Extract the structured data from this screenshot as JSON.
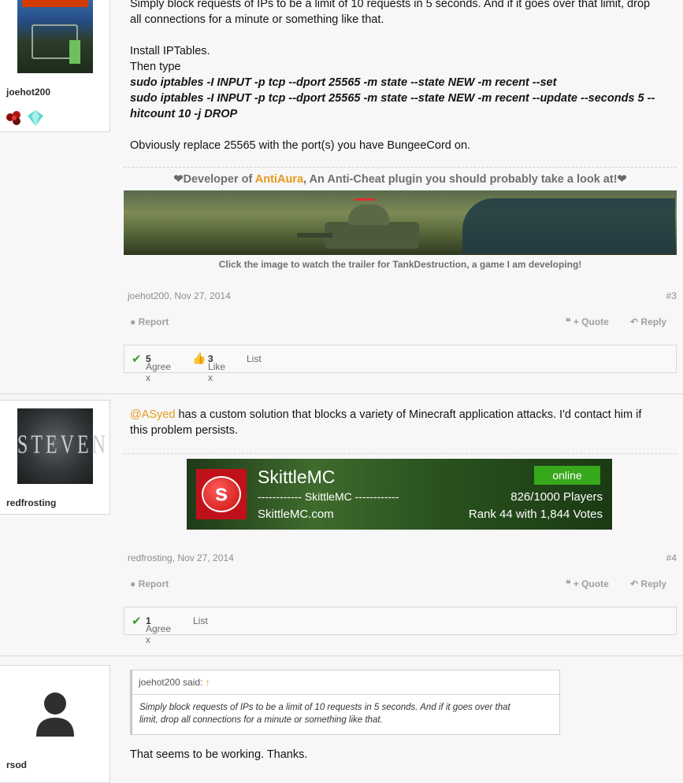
{
  "post2": {
    "username": "joehot200",
    "message_line1": "Simply block requests of IPs to be a limit of 10 requests in 5 seconds. And if it goes over that limit, drop",
    "message_line2": "all connections for a minute or something like that.",
    "install": "Install IPTables.",
    "then_type": "Then type",
    "cmd1": "sudo iptables -I INPUT -p tcp --dport 25565 -m state --state NEW -m recent --set",
    "cmd2a": "sudo iptables -I INPUT -p tcp --dport 25565 -m state --state NEW -m recent --update --seconds 5 --",
    "cmd2b": "hitcount 10 -j DROP",
    "replace": "Obviously replace 25565 with the port(s) you have BungeeCord on.",
    "sig_prefix": "Developer of ",
    "sig_link": "AntiAura",
    "sig_suffix": ", An Anti-Cheat plugin you should probably take a look at!",
    "sig_caption": "Click the image to watch the trailer for TankDestruction, a game I am developing!",
    "meta": "joehot200, Nov 27, 2014",
    "number": "#3",
    "report": "Report",
    "quote": "+ Quote",
    "reply": "Reply",
    "agree": "Agree x",
    "agree_count": "5",
    "like": "Like x",
    "like_count": "3",
    "list": "List"
  },
  "post3": {
    "username": "redfrosting",
    "avatar_text": "STEVEN",
    "mention": "@ASyed",
    "message_line1": " has a custom solution that blocks a variety of Minecraft application attacks. I'd contact him if",
    "message_line2": "this problem persists.",
    "banner": {
      "name": "SkittleMC",
      "status": "online",
      "motd": "------------ SkittleMC ------------",
      "players": "826/1000 Players",
      "domain": "SkittleMC.com",
      "rank": "Rank 44 with 1,844 Votes"
    },
    "meta": "redfrosting, Nov 27, 2014",
    "number": "#4",
    "report": "Report",
    "quote": "+ Quote",
    "reply": "Reply",
    "agree": "Agree x",
    "agree_count": "1",
    "list": "List"
  },
  "post4": {
    "username": "rsod",
    "quote_author": "joehot200 said:",
    "quote_text_line1": "Simply block requests of IPs to be a limit of 10 requests in 5 seconds. And if it goes over that",
    "quote_text_line2": "limit, drop all connections for a minute or something like that.",
    "message": "That seems to be working. Thanks."
  }
}
